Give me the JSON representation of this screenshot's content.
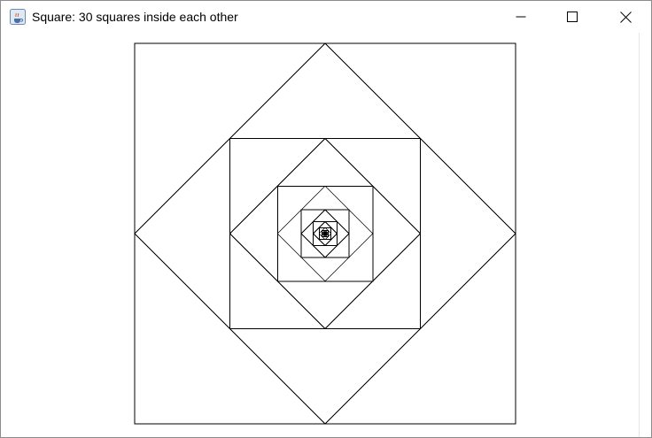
{
  "window": {
    "title": "Square: 30 squares inside each other",
    "app_icon": "java-cup-icon"
  },
  "titlebar_buttons": {
    "minimize": "minimize-icon",
    "maximize": "maximize-icon",
    "close": "close-icon"
  },
  "drawing": {
    "square_count": 30,
    "stroke_color": "#000000",
    "background_color": "#ffffff"
  }
}
